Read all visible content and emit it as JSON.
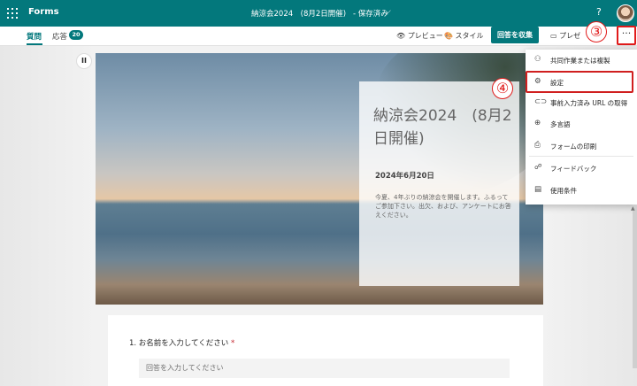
{
  "topbar": {
    "app_name": "Forms",
    "doc_title": "納涼会2024　(8月2日開催)",
    "save_state": "- 保存済み",
    "title_chevron": "⌵",
    "help": "?",
    "brand_color": "#03787c"
  },
  "cmdbar": {
    "tab_questions": "質問",
    "tab_responses": "応答",
    "response_count": "20",
    "preview": "プレビュー",
    "style": "スタイル",
    "collect": "回答を収集",
    "present": "プレゼ",
    "more": "···"
  },
  "hero": {
    "title": "納涼会2024　(8月2日開催)",
    "date": "2024年6月20日",
    "description": "今夏、4年ぶりの納涼会を開催します。ふるってご参加下さい。出欠、および、アンケートにお答えください。"
  },
  "question": {
    "label": "1. お名前を入力してください",
    "required_mark": "*",
    "placeholder": "回答を入力してください"
  },
  "menu": {
    "items": [
      {
        "icon": "people-icon",
        "label": "共同作業または複製"
      },
      {
        "icon": "gear-icon",
        "label": "設定"
      },
      {
        "icon": "link-icon",
        "label": "事前入力済み URL の取得"
      },
      {
        "icon": "globe-icon",
        "label": "多言語"
      },
      {
        "icon": "printer-icon",
        "label": "フォームの印刷"
      },
      {
        "icon": "feedback-icon",
        "label": "フィードバック"
      },
      {
        "icon": "document-icon",
        "label": "使用条件"
      }
    ]
  },
  "steps": {
    "step3": "③",
    "step4": "④"
  },
  "accent_colors": {
    "highlight": "#e11b1b"
  }
}
